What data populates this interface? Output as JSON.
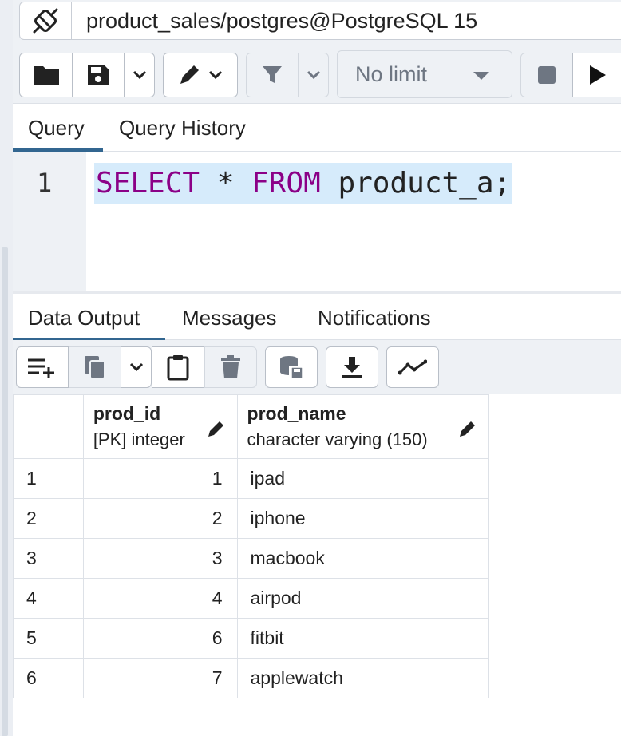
{
  "connection": {
    "title": "product_sales/postgres@PostgreSQL 15",
    "icon": "disconnected-plug-icon"
  },
  "toolbar": {
    "row_limit": "No limit",
    "icons": [
      "folder-icon",
      "save-icon",
      "chevron-down-icon",
      "pen-icon",
      "filter-icon",
      "stop-icon",
      "play-icon"
    ]
  },
  "query_tabs": [
    {
      "label": "Query",
      "active": true
    },
    {
      "label": "Query History",
      "active": false
    }
  ],
  "editor": {
    "line_number": "1",
    "tokens": [
      {
        "text": "SELECT",
        "kind": "keyword"
      },
      {
        "text": " * ",
        "kind": "text"
      },
      {
        "text": "FROM",
        "kind": "keyword"
      },
      {
        "text": " product_a;",
        "kind": "text"
      }
    ],
    "keyword_color": "#8b0087",
    "selection_color": "#d6ebfb"
  },
  "output_tabs": [
    {
      "label": "Data Output",
      "active": true
    },
    {
      "label": "Messages",
      "active": false
    },
    {
      "label": "Notifications",
      "active": false
    }
  ],
  "grid": {
    "columns": [
      {
        "name": "prod_id",
        "type": "[PK] integer"
      },
      {
        "name": "prod_name",
        "type": "character varying (150)"
      }
    ],
    "rows": [
      {
        "n": "1",
        "prod_id": "1",
        "prod_name": "ipad"
      },
      {
        "n": "2",
        "prod_id": "2",
        "prod_name": "iphone"
      },
      {
        "n": "3",
        "prod_id": "3",
        "prod_name": "macbook"
      },
      {
        "n": "4",
        "prod_id": "4",
        "prod_name": "airpod"
      },
      {
        "n": "5",
        "prod_id": "6",
        "prod_name": "fitbit"
      },
      {
        "n": "6",
        "prod_id": "7",
        "prod_name": "applewatch"
      }
    ]
  },
  "colors": {
    "accent": "#326690",
    "toolbar_bg": "#eef1f5"
  }
}
